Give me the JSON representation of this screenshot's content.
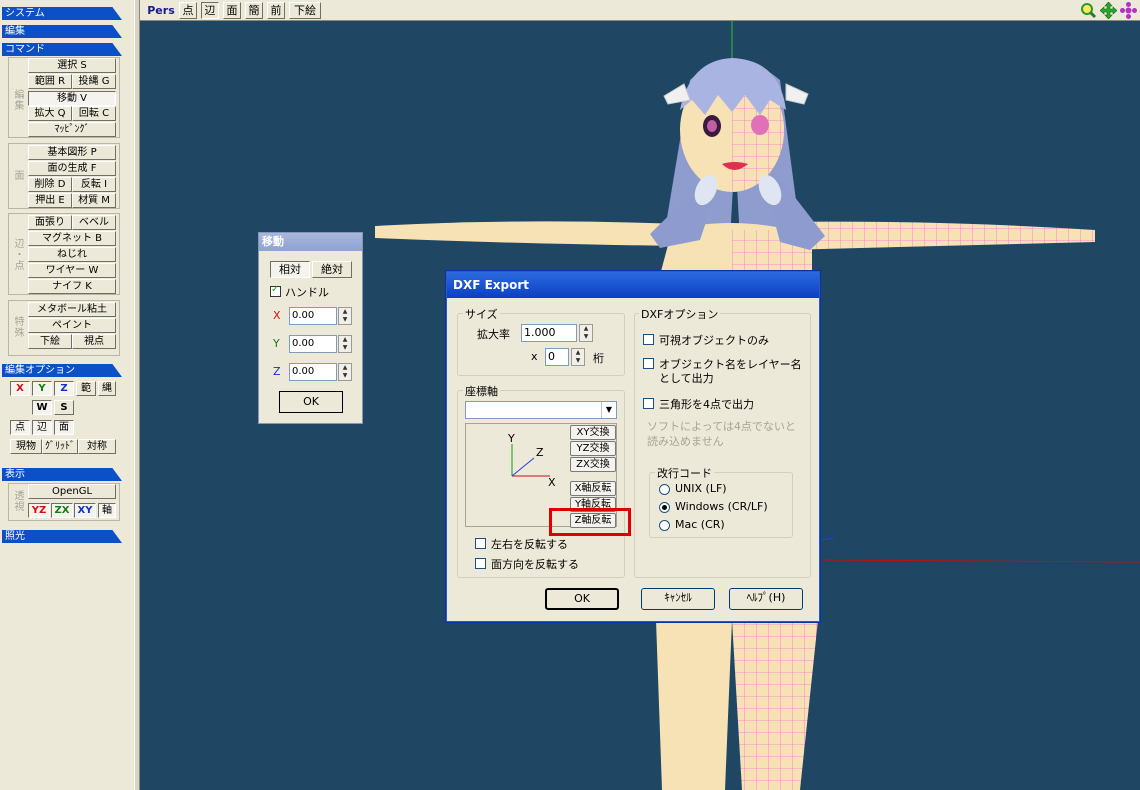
{
  "left_panel": {
    "sections": {
      "system": "システム",
      "edit": "編集",
      "command": "コマンド",
      "edit_options": "編集オプション",
      "display": "表示",
      "lighting": "照光"
    },
    "vertical_labels": {
      "edit": "編集",
      "face": "面",
      "edge_point": "辺・点",
      "special": "特殊",
      "perspective": "透視"
    },
    "commands": {
      "select": "選択 S",
      "range": "範囲 R",
      "lasso": "投縄 G",
      "move": "移動 V",
      "scale": "拡大 Q",
      "rotate": "回転 C",
      "mapping": "ﾏｯﾋﾟﾝｸﾞ",
      "primitive": "基本図形 P",
      "create_face": "面の生成 F",
      "delete": "削除 D",
      "invert": "反転 I",
      "extrude": "押出 E",
      "material": "材質 M",
      "bevel_face": "面張り",
      "bevel": "ベベル",
      "magnet": "マグネット B",
      "twist": "ねじれ",
      "wire": "ワイヤー W",
      "knife": "ナイフ K",
      "metaball": "メタボール粘土",
      "paint": "ペイント",
      "underlay": "下絵",
      "viewpoint": "視点"
    },
    "edit_options": {
      "x": "X",
      "y": "Y",
      "z": "Z",
      "range": "範",
      "lasso": "縄",
      "w": "W",
      "s": "S",
      "point": "点",
      "edge": "辺",
      "face": "面",
      "current": "現物",
      "grid": "ｸﾞﾘｯﾄﾞ",
      "symmetry": "対称"
    },
    "display": {
      "opengl": "OpenGL",
      "yz": "YZ",
      "zx": "ZX",
      "xy": "XY",
      "axis": "軸"
    }
  },
  "toolbar": {
    "pers": "Pers",
    "point": "点",
    "edge": "辺",
    "face": "面",
    "simple": "簡",
    "front": "前",
    "underlay": "下絵",
    "icons": [
      "zoom-icon",
      "pan-icon",
      "rotate-view-icon"
    ]
  },
  "move_panel": {
    "title": "移動",
    "relative": "相対",
    "absolute": "絶対",
    "handle_label": "ハンドル",
    "handle_checked": true,
    "x_label": "X",
    "x_value": "0.00",
    "y_label": "Y",
    "y_value": "0.00",
    "z_label": "Z",
    "z_value": "0.00",
    "ok": "OK"
  },
  "dxf_dialog": {
    "title": "DXF Export",
    "size": {
      "legend": "サイズ",
      "scale_label": "拡大率",
      "scale_value": "1.000",
      "x_prefix": "x",
      "digits_value": "0",
      "digits_label": "桁"
    },
    "axis": {
      "legend": "座標軸",
      "select_value": "",
      "diagram_labels": {
        "y": "Y",
        "z": "Z",
        "x": "X"
      },
      "swap_xy": "XY交換",
      "swap_yz": "YZ交換",
      "swap_zx": "ZX交換",
      "flip_x": "X軸反転",
      "flip_y": "Y軸反転",
      "flip_z": "Z軸反転",
      "mirror_lr": "左右を反転する",
      "flip_face": "面方向を反転する"
    },
    "options": {
      "legend": "DXFオプション",
      "visible_only": "可視オブジェクトのみ",
      "object_as_layer_1": "オブジェクト名をレイヤー名",
      "object_as_layer_2": "として出力",
      "triangle_4pts": "三角形を4点で出力",
      "note_1": "ソフトによっては4点でないと",
      "note_2": "読み込めません"
    },
    "newline": {
      "legend": "改行コード",
      "unix": "UNIX (LF)",
      "windows": "Windows (CR/LF)",
      "mac": "Mac (CR)",
      "selected": "windows"
    },
    "buttons": {
      "ok": "OK",
      "cancel": "ｷｬﾝｾﾙ",
      "help": "ﾍﾙﾌﾟ(H)"
    }
  },
  "colors": {
    "viewport_bg": "#1f4663",
    "section_header": "#0c50c8",
    "highlight": "#e00000",
    "skin": "#f7e2b6",
    "hair": "#9aa6d8",
    "wire": "#ff6ad5"
  }
}
